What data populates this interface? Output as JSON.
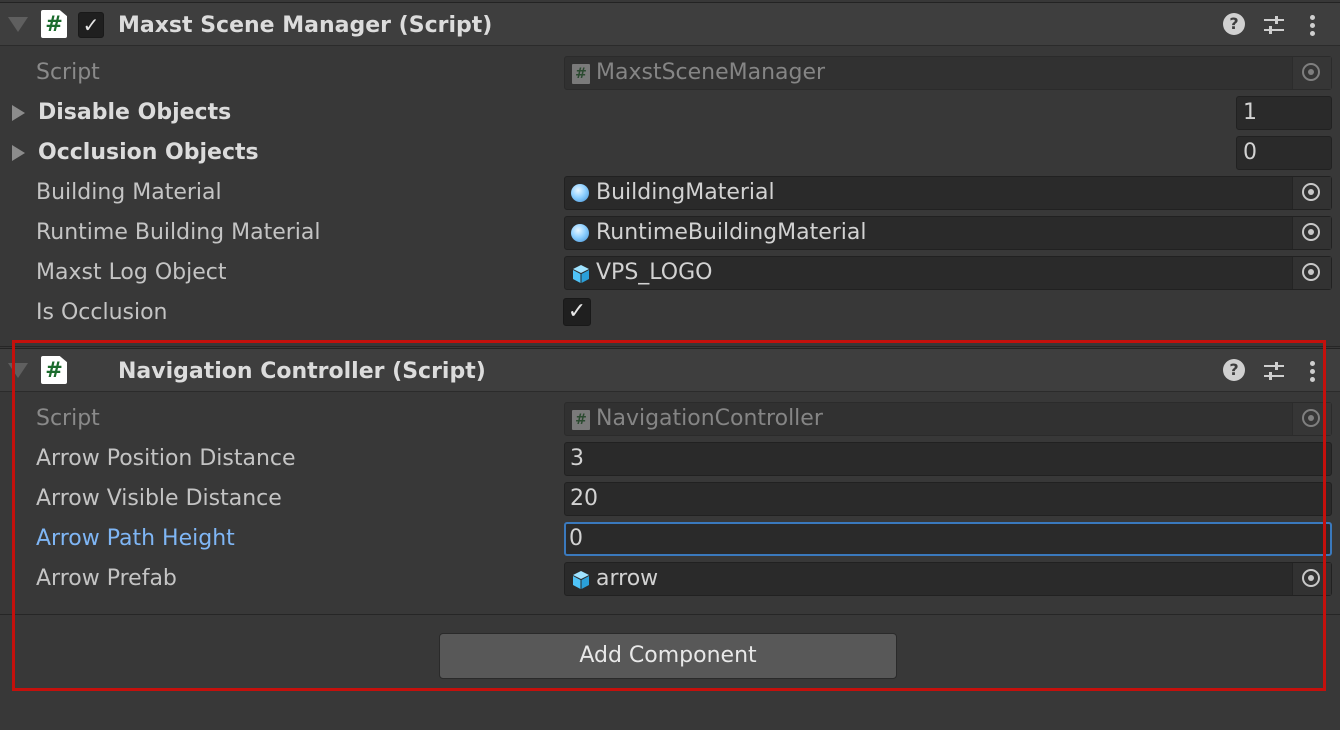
{
  "components": [
    {
      "title": "Maxst Scene Manager (Script)",
      "enabled": true,
      "script_field_label": "Script",
      "script_value": "MaxstSceneManager",
      "disable_objects": {
        "label": "Disable Objects",
        "size": "1"
      },
      "occlusion_objects": {
        "label": "Occlusion Objects",
        "size": "0"
      },
      "building_material": {
        "label": "Building Material",
        "value": "BuildingMaterial"
      },
      "runtime_building_material": {
        "label": "Runtime Building Material",
        "value": "RuntimeBuildingMaterial"
      },
      "maxst_log_object": {
        "label": "Maxst Log Object",
        "value": "VPS_LOGO"
      },
      "is_occlusion": {
        "label": "Is Occlusion",
        "checked": true
      }
    },
    {
      "title": "Navigation Controller (Script)",
      "script_field_label": "Script",
      "script_value": "NavigationController",
      "arrow_position_distance": {
        "label": "Arrow Position Distance",
        "value": "3"
      },
      "arrow_visible_distance": {
        "label": "Arrow Visible Distance",
        "value": "20"
      },
      "arrow_path_height": {
        "label": "Arrow Path Height",
        "value": "0"
      },
      "arrow_prefab": {
        "label": "Arrow Prefab",
        "value": "arrow"
      }
    }
  ],
  "add_component_label": "Add Component",
  "icons": {
    "script": "#",
    "check": "✓",
    "help": "?",
    "settings": "sliders-icon",
    "menu": "kebab-menu-icon",
    "material": "material-sphere-icon",
    "prefab": "prefab-cube-icon",
    "object_picker": "object-picker-icon"
  },
  "colors": {
    "panel_bg": "#383838",
    "header_bg": "#3e3e3e",
    "focus_label": "#7fb6f5",
    "focus_border": "#3a79bd",
    "highlight_box": "#c4100c",
    "script_icon_hash": "#1b6b2d",
    "prefab_icon": "#4fc3f7"
  }
}
